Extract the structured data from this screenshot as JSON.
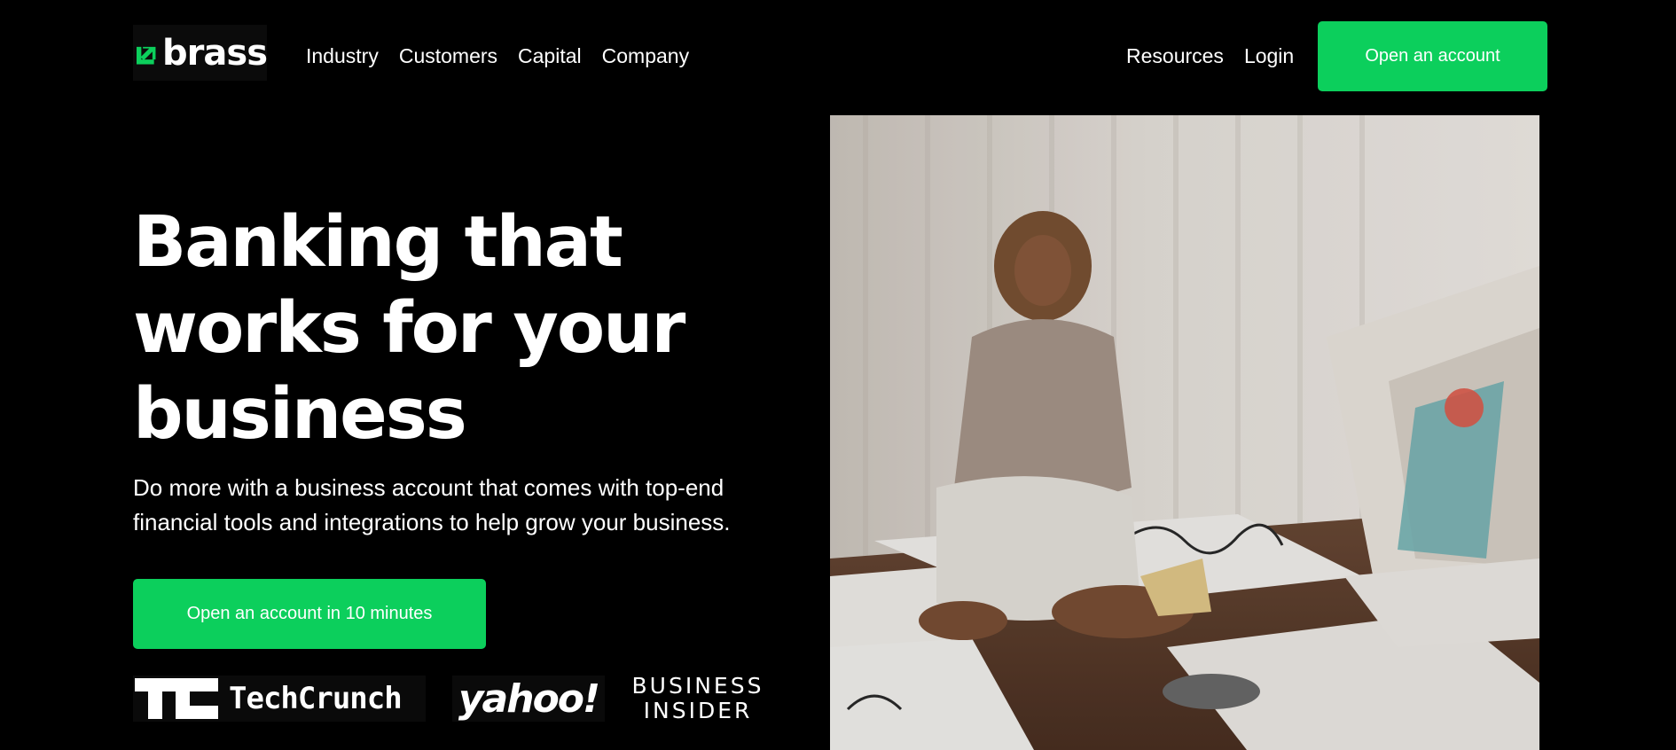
{
  "brand": {
    "name": "brass",
    "logo_icon": "arrow-up-right-icon",
    "accent_color": "#0ccf5c"
  },
  "nav": {
    "left": [
      "Industry",
      "Customers",
      "Capital",
      "Company"
    ],
    "right": [
      "Resources",
      "Login"
    ],
    "cta_label": "Open an account"
  },
  "hero": {
    "title": "Banking that works for your business",
    "subtitle": "Do more with a business account that comes with top-end financial tools and integrations to help grow your business.",
    "cta_label": "Open an account in 10 minutes"
  },
  "press": {
    "logos": [
      "TechCrunch",
      "yahoo!",
      "BUSINESS INSIDER"
    ],
    "techcrunch": "TechCrunch",
    "yahoo": "yahoo!",
    "business_insider_line1": "BUSINESS",
    "business_insider_line2": "INSIDER"
  },
  "hero_image": {
    "subject": "woman kneeling on floor among large paper sheets"
  }
}
